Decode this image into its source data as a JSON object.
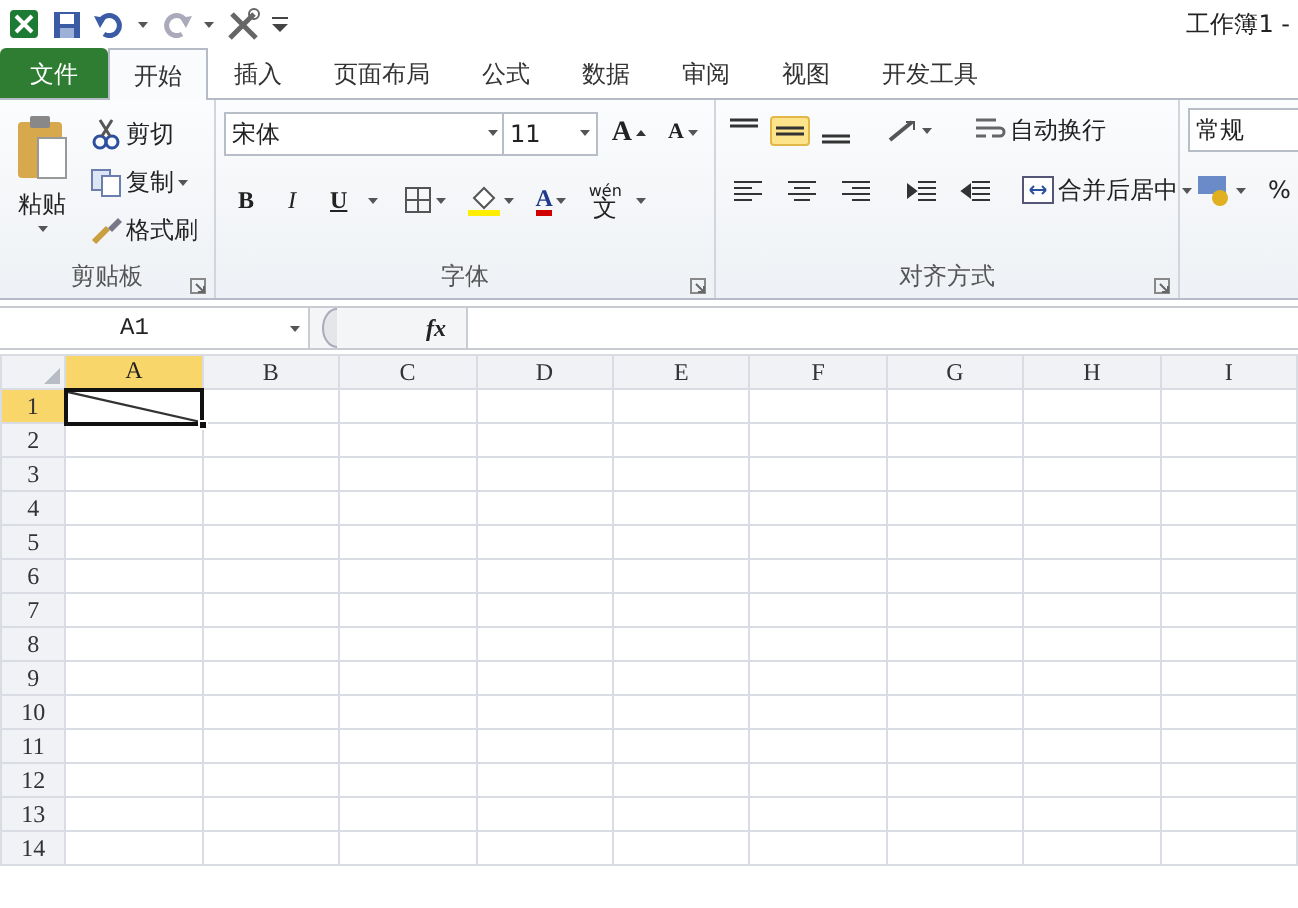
{
  "window": {
    "title": "工作簿1 -"
  },
  "tabs": [
    {
      "label": "文件",
      "kind": "file",
      "selected": false
    },
    {
      "label": "开始",
      "kind": "tab",
      "selected": true
    },
    {
      "label": "插入",
      "kind": "tab",
      "selected": false
    },
    {
      "label": "页面布局",
      "kind": "tab",
      "selected": false
    },
    {
      "label": "公式",
      "kind": "tab",
      "selected": false
    },
    {
      "label": "数据",
      "kind": "tab",
      "selected": false
    },
    {
      "label": "审阅",
      "kind": "tab",
      "selected": false
    },
    {
      "label": "视图",
      "kind": "tab",
      "selected": false
    },
    {
      "label": "开发工具",
      "kind": "tab",
      "selected": false
    }
  ],
  "clipboard": {
    "paste": "粘贴",
    "cut": "剪切",
    "copy": "复制",
    "format_painter": "格式刷",
    "label": "剪贴板"
  },
  "font": {
    "font_name": "宋体",
    "font_size": "11",
    "grow": "A",
    "shrink": "A",
    "bold": "B",
    "italic": "I",
    "underline": "U",
    "font_color": "A",
    "phonetic_top": "wén",
    "phonetic_bottom": "文",
    "label": "字体"
  },
  "alignment": {
    "vertical": [
      {
        "kind": "top",
        "selected": false
      },
      {
        "kind": "middle",
        "selected": true
      },
      {
        "kind": "bottom",
        "selected": false
      }
    ],
    "wrap_text": "自动换行",
    "merge": "合并后居中",
    "label": "对齐方式"
  },
  "number": {
    "format": "常规",
    "percent": "%"
  },
  "formula_bar": {
    "name_box": "A1",
    "fx": "fx"
  },
  "sheet": {
    "columns": [
      {
        "label": "A",
        "selected": true
      },
      {
        "label": "B",
        "selected": false
      },
      {
        "label": "C",
        "selected": false
      },
      {
        "label": "D",
        "selected": false
      },
      {
        "label": "E",
        "selected": false
      },
      {
        "label": "F",
        "selected": false
      },
      {
        "label": "G",
        "selected": false
      },
      {
        "label": "H",
        "selected": false
      },
      {
        "label": "I",
        "selected": false
      }
    ],
    "rows": [
      {
        "label": "1",
        "selected": true
      },
      {
        "label": "2",
        "selected": false
      },
      {
        "label": "3",
        "selected": false
      },
      {
        "label": "4",
        "selected": false
      },
      {
        "label": "5",
        "selected": false
      },
      {
        "label": "6",
        "selected": false
      },
      {
        "label": "7",
        "selected": false
      },
      {
        "label": "8",
        "selected": false
      },
      {
        "label": "9",
        "selected": false
      },
      {
        "label": "10",
        "selected": false
      },
      {
        "label": "11",
        "selected": false
      },
      {
        "label": "12",
        "selected": false
      },
      {
        "label": "13",
        "selected": false
      },
      {
        "label": "14",
        "selected": false
      }
    ],
    "active_cell": {
      "diagonal_border": true
    }
  }
}
